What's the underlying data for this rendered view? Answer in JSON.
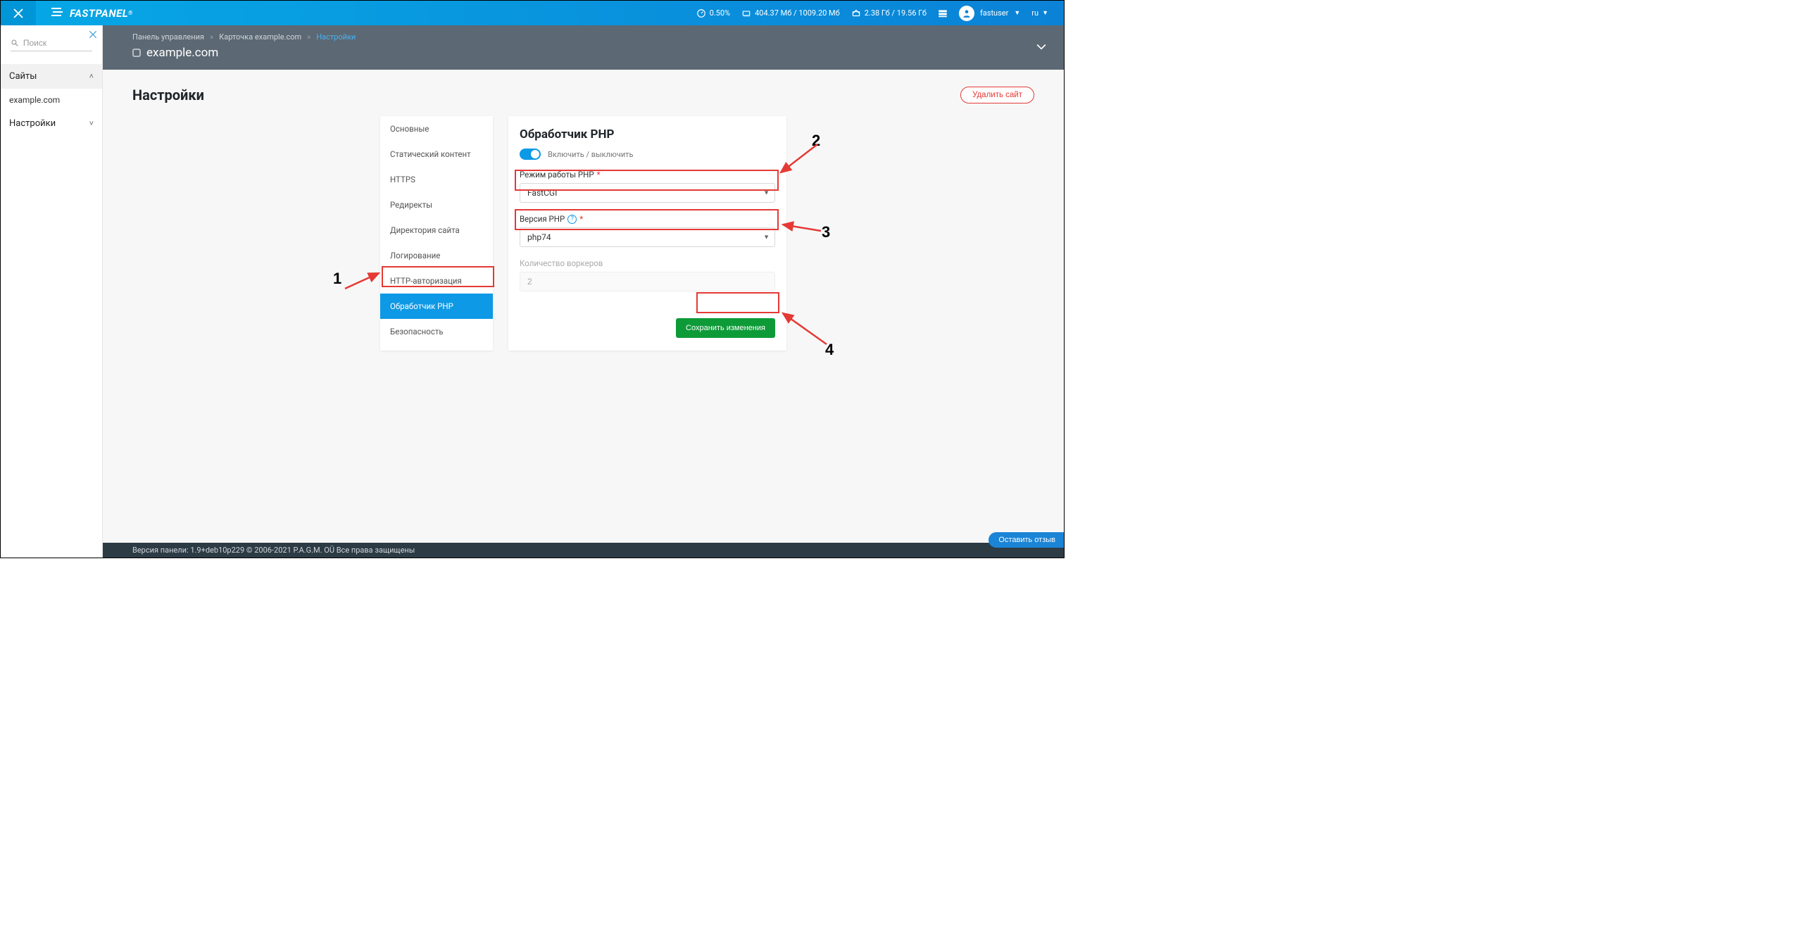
{
  "header": {
    "cpu": "0.50%",
    "ram": "404.37 Мб / 1009.20 Мб",
    "disk": "2.38 Гб / 19.56 Гб",
    "user": "fastuser",
    "lang": "ru",
    "logo_text": "FASTPANEL"
  },
  "sidebar": {
    "search_placeholder": "Поиск",
    "sections": [
      {
        "label": "Сайты",
        "expanded": true,
        "items": [
          "example.com"
        ]
      },
      {
        "label": "Настройки",
        "expanded": false,
        "items": []
      }
    ]
  },
  "breadcrumb": {
    "items": [
      "Панель управления",
      "Карточка example.com",
      "Настройки"
    ]
  },
  "site_title": "example.com",
  "page": {
    "title": "Настройки",
    "delete_label": "Удалить сайт"
  },
  "settings_tabs": [
    "Основные",
    "Статический контент",
    "HTTPS",
    "Редиректы",
    "Директория сайта",
    "Логирование",
    "HTTP-авторизация",
    "Обработчик PHP",
    "Безопасность"
  ],
  "form": {
    "title": "Обработчик PHP",
    "toggle_label": "Включить / выключить",
    "toggle_on": true,
    "mode_label": "Режим работы PHP",
    "mode_value": "FastCGI",
    "version_label": "Версия PHP",
    "version_value": "php74",
    "workers_label": "Количество воркеров",
    "workers_value": "2",
    "save_label": "Сохранить изменения"
  },
  "footer": {
    "text": "Версия панели: 1.9+deb10p229 © 2006-2021 P.A.G.M. OÜ Все права защищены",
    "feedback": "Оставить отзыв"
  },
  "annotations": {
    "a1": "1",
    "a2": "2",
    "a3": "3",
    "a4": "4"
  }
}
